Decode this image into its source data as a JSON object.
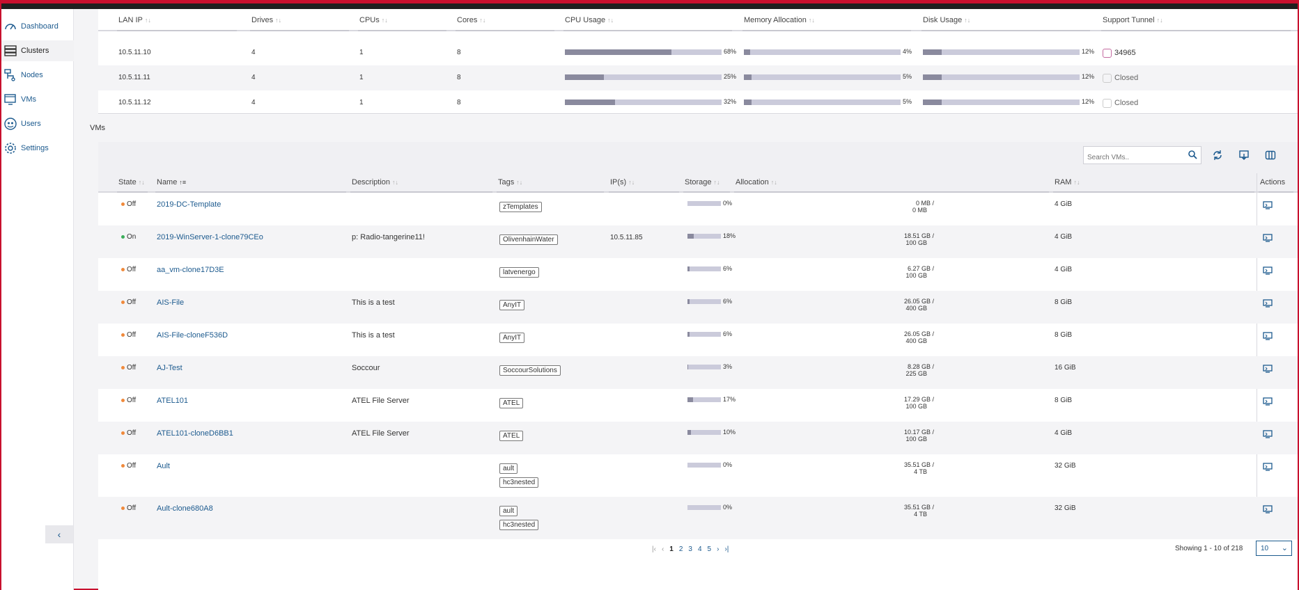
{
  "brand_colors": {
    "accent": "#c8102e",
    "link": "#1c5a8e",
    "bar_fill": "#8a8a9e",
    "bar_track": "#cbcbdb",
    "off": "#f08a3c",
    "on": "#3cae5a"
  },
  "sidebar": {
    "items": [
      {
        "label": "Dashboard",
        "icon": "gauge-icon"
      },
      {
        "label": "Clusters",
        "icon": "server-stack-icon"
      },
      {
        "label": "Nodes",
        "icon": "nodes-icon"
      },
      {
        "label": "VMs",
        "icon": "vm-monitor-icon"
      },
      {
        "label": "Users",
        "icon": "users-icon"
      },
      {
        "label": "Settings",
        "icon": "gear-icon"
      }
    ],
    "collapse_icon": "chevron-left-icon"
  },
  "cluster_table": {
    "headers": [
      "LAN IP",
      "Drives",
      "CPUs",
      "Cores",
      "CPU Usage",
      "Memory Allocation",
      "Disk Usage",
      "Support Tunnel"
    ],
    "rows": [
      {
        "lan_ip": "10.5.11.10",
        "drives": "4",
        "cpus": "1",
        "cores": "8",
        "cpu": 0.68,
        "cpu_label": "68%",
        "mem": 0.04,
        "mem_label": "4%",
        "disk": 0.12,
        "disk_label": "12%",
        "tunnel": "34965",
        "tunnel_open": true
      },
      {
        "lan_ip": "10.5.11.11",
        "drives": "4",
        "cpus": "1",
        "cores": "8",
        "cpu": 0.25,
        "cpu_label": "25%",
        "mem": 0.05,
        "mem_label": "5%",
        "disk": 0.12,
        "disk_label": "12%",
        "tunnel": "Closed",
        "tunnel_open": false
      },
      {
        "lan_ip": "10.5.11.12",
        "drives": "4",
        "cpus": "1",
        "cores": "8",
        "cpu": 0.32,
        "cpu_label": "32%",
        "mem": 0.05,
        "mem_label": "5%",
        "disk": 0.12,
        "disk_label": "12%",
        "tunnel": "Closed",
        "tunnel_open": false
      }
    ]
  },
  "vms_label": "VMs",
  "vm_toolbar": {
    "search_placeholder": "Search VMs..",
    "icons": [
      "search-icon",
      "refresh-icon",
      "import-icon",
      "columns-icon"
    ]
  },
  "vm_table": {
    "headers": [
      "State",
      "Name",
      "Description",
      "Tags",
      "IP(s)",
      "Storage",
      "Allocation",
      "RAM",
      "Actions"
    ],
    "rows": [
      {
        "state": "Off",
        "name": "2019-DC-Template",
        "description": "",
        "tags": [
          "zTemplates"
        ],
        "ips": "",
        "storage": 0.0,
        "storage_label": "0%",
        "alloc_used": "0 MB /",
        "alloc_total": "0 MB",
        "ram": "4 GiB"
      },
      {
        "state": "On",
        "name": "2019-WinServer-1-clone79CEo",
        "description": "p: Radio-tangerine11!",
        "tags": [
          "OlivenhainWater"
        ],
        "ips": "10.5.11.85",
        "storage": 0.18,
        "storage_label": "18%",
        "alloc_used": "18.51 GB /",
        "alloc_total": "100 GB",
        "ram": "4 GiB"
      },
      {
        "state": "Off",
        "name": "aa_vm-clone17D3E",
        "description": "",
        "tags": [
          "latvenergo"
        ],
        "ips": "",
        "storage": 0.06,
        "storage_label": "6%",
        "alloc_used": "6.27 GB /",
        "alloc_total": "100 GB",
        "ram": "4 GiB"
      },
      {
        "state": "Off",
        "name": "AIS-File",
        "description": "This is a test",
        "tags": [
          "AnyIT"
        ],
        "ips": "",
        "storage": 0.06,
        "storage_label": "6%",
        "alloc_used": "26.05 GB /",
        "alloc_total": "400 GB",
        "ram": "8 GiB"
      },
      {
        "state": "Off",
        "name": "AIS-File-cloneF536D",
        "description": "This is a test",
        "tags": [
          "AnyIT"
        ],
        "ips": "",
        "storage": 0.06,
        "storage_label": "6%",
        "alloc_used": "26.05 GB /",
        "alloc_total": "400 GB",
        "ram": "8 GiB"
      },
      {
        "state": "Off",
        "name": "AJ-Test",
        "description": "Soccour",
        "tags": [
          "SoccourSolutions"
        ],
        "ips": "",
        "storage": 0.03,
        "storage_label": "3%",
        "alloc_used": "8.28 GB /",
        "alloc_total": "225 GB",
        "ram": "16 GiB"
      },
      {
        "state": "Off",
        "name": "ATEL101",
        "description": "ATEL File Server",
        "tags": [
          "ATEL"
        ],
        "ips": "",
        "storage": 0.17,
        "storage_label": "17%",
        "alloc_used": "17.29 GB /",
        "alloc_total": "100 GB",
        "ram": "8 GiB"
      },
      {
        "state": "Off",
        "name": "ATEL101-cloneD6BB1",
        "description": "ATEL File Server",
        "tags": [
          "ATEL"
        ],
        "ips": "",
        "storage": 0.1,
        "storage_label": "10%",
        "alloc_used": "10.17 GB /",
        "alloc_total": "100 GB",
        "ram": "4 GiB"
      },
      {
        "state": "Off",
        "name": "Ault",
        "description": "",
        "tags": [
          "ault",
          "hc3nested"
        ],
        "ips": "",
        "storage": 0.0,
        "storage_label": "0%",
        "alloc_used": "35.51 GB /",
        "alloc_total": "4 TB",
        "ram": "32 GiB"
      },
      {
        "state": "Off",
        "name": "Ault-clone680A8",
        "description": "",
        "tags": [
          "ault",
          "hc3nested"
        ],
        "ips": "",
        "storage": 0.0,
        "storage_label": "0%",
        "alloc_used": "35.51 GB /",
        "alloc_total": "4 TB",
        "ram": "32 GiB"
      }
    ]
  },
  "pagination": {
    "pages": [
      "1",
      "2",
      "3",
      "4",
      "5"
    ],
    "current": "1",
    "first_icon": "first-page-icon",
    "prev_icon": "chevron-left-icon",
    "next_icon": "chevron-right-icon",
    "last_icon": "last-page-icon",
    "showing": "Showing 1 - 10 of 218",
    "per_page": "10"
  }
}
